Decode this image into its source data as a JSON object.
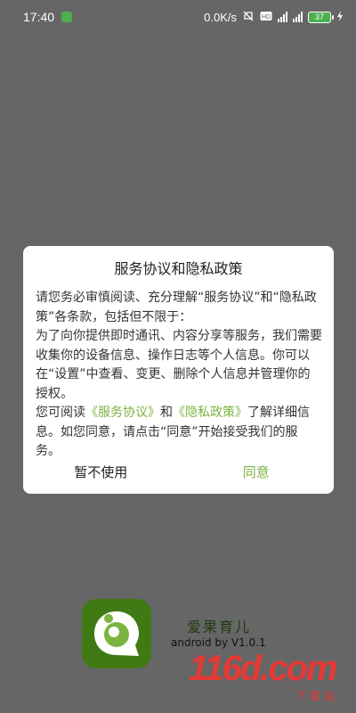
{
  "status_bar": {
    "time": "17:40",
    "net_speed": "0.0K/s",
    "battery": "37"
  },
  "dialog": {
    "title": "服务协议和隐私政策",
    "p1": "请您务必审慎阅读、充分理解“服务协议”和“隐私政策”各条款，包括但不限于：",
    "p2": "为了向你提供即时通讯、内容分享等服务，我们需要收集你的设备信息、操作日志等个人信息。你可以在“设置”中查看、变更、删除个人信息并管理你的授权。",
    "p3_prefix": "您可阅读",
    "service_link": "《服务协议》",
    "p3_and": "和",
    "privacy_link": "《隐私政策》",
    "p3_suffix": "了解详细信息。如您同意，请点击“同意”开始接受我们的服务。",
    "cancel_label": "暂不使用",
    "agree_label": "同意"
  },
  "app": {
    "name": "爱果育儿",
    "version": "android by V1.0.1"
  },
  "watermark": {
    "logo": "116d.com",
    "sub": "下载站"
  },
  "colors": {
    "accent": "#7cb342",
    "overlay": "#666666",
    "logo_bg": "#3f7a14"
  }
}
